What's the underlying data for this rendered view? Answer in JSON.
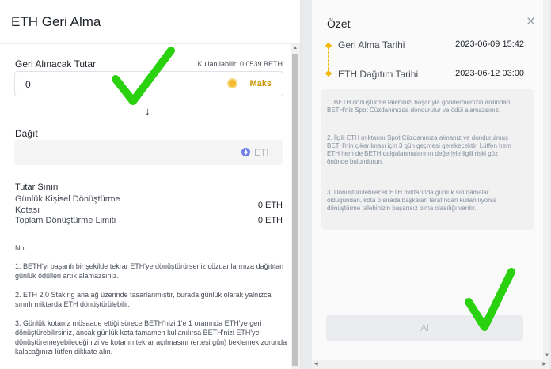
{
  "left": {
    "title": "ETH Geri Alma",
    "amount_label": "Geri Alınacak Tutar",
    "available": "Kullanılabilir: 0.0539 BETH",
    "amount_value": "0",
    "max_label": "Maks",
    "arrow": "↓",
    "distribute_label": "Dağıt",
    "distribute_unit": "ETH",
    "limits_title": "Tutar Sınırı",
    "limit_daily_label": "Günlük Kişisel Dönüştürme Kotası",
    "limit_daily_value": "0 ETH",
    "limit_total_label": "Toplam Dönüştürme Limiti",
    "limit_total_value": "0 ETH",
    "note_title": "Not:",
    "notes": [
      "1. BETH'yi başarılı bir şekilde tekrar ETH'ye dönüştürürseniz cüzdanlarınıza dağıtılan günlük ödülleri artık alamazsınız.",
      "2. ETH 2.0 Staking ana ağ üzerinde tasarlanmıştır, burada günlük olarak yalnızca sınırlı miktarda ETH dönüştürülebilir.",
      "3. Günlük kotanız müsaade ettiği sürece BETH'nizi 1'e 1 oranında ETH'ye geri dönüştürebilirsiniz, ancak günlük kota tamamen kullanılırsa BETH'nizi ETH'ye dönüştüremeyebileceğinizi ve kotanın tekrar açılmasını (ertesi gün) beklemek zorunda kalacağınızı lütfen dikkate alın."
    ]
  },
  "right": {
    "title": "Özet",
    "close": "×",
    "timeline": [
      {
        "label": "Geri Alma Tarihi",
        "date": "2023-06-09 15:42"
      },
      {
        "label": "ETH Dağıtım Tarihi",
        "date": "2023-06-12 03:00"
      }
    ],
    "info": [
      "1. BETH dönüştürme talebinizi başarıyla göndermenizin ardından BETH'niz Spot Cüzdanınızda dondurulur ve ödül alamazsınız.",
      "2. İlgili ETH miktarını Spot Cüzdanınıza almanız ve dondurulmuş BETH'nin çıkarılması için 3 gün geçmesi gerekecektir. Lütfen hem ETH hem de BETH dalgalanmalarının değeriyle ilgili riski göz önünde bulundurun.",
      "3. Dönüştürülebilecek ETH miktarında günlük sınırlamalar olduğundan, kota o sırada başkaları tarafından kullanılıyorsa dönüştürme talebinizin başarısız olma olasılığı vardır."
    ],
    "claim_label": "Al"
  },
  "colors": {
    "accent": "#f0b90b",
    "max_text": "#c99400",
    "check_mark": "#2ad10f"
  }
}
